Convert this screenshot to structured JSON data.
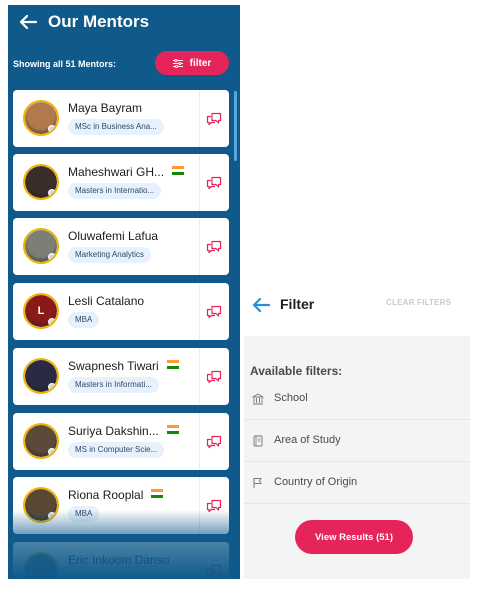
{
  "left_panel": {
    "title": "Our Mentors",
    "showing_text": "Showing all 51 Mentors:",
    "filter_label": "filter",
    "mentors": [
      {
        "name": "Maya Bayram",
        "tag": "MSc in Business Ana...",
        "flag": "",
        "avatar_color": "#b07a4e"
      },
      {
        "name": "Maheshwari GH...",
        "tag": "Masters in Internatio...",
        "flag": "india",
        "avatar_color": "#3b2d2a"
      },
      {
        "name": "Oluwafemi Lafua",
        "tag": "Marketing Analytics",
        "flag": "",
        "avatar_color": "#7b7f76"
      },
      {
        "name": "Lesli Catalano",
        "tag": "MBA",
        "flag": "",
        "avatar_color": "#8a1a1a",
        "avatar_letter": "L"
      },
      {
        "name": "Swapnesh Tiwari",
        "tag": "Masters in Informati...",
        "flag": "india",
        "avatar_color": "#2a2a44"
      },
      {
        "name": "Suriya Dakshin...",
        "tag": "MS in Computer Scie...",
        "flag": "india",
        "avatar_color": "#5b4a3a"
      },
      {
        "name": "Riona Rooplal",
        "tag": "MBA",
        "flag": "india",
        "avatar_color": "#5a4736"
      },
      {
        "name": "Eric Inkoom Danso",
        "tag": "",
        "flag": "",
        "avatar_color": "#5b6d7e"
      }
    ]
  },
  "right_panel": {
    "title": "Filter",
    "clear_label": "CLEAR FILTERS",
    "available_label": "Available filters:",
    "options": [
      {
        "label": "School",
        "icon": "school-icon"
      },
      {
        "label": "Area of Study",
        "icon": "book-icon"
      },
      {
        "label": "Country of Origin",
        "icon": "flag-icon"
      }
    ],
    "view_results_label": "View Results (51)"
  },
  "colors": {
    "panel_blue": "#0f5a8a",
    "accent_pink": "#e5245a",
    "back_arrow_blue": "#2a8fd8"
  }
}
